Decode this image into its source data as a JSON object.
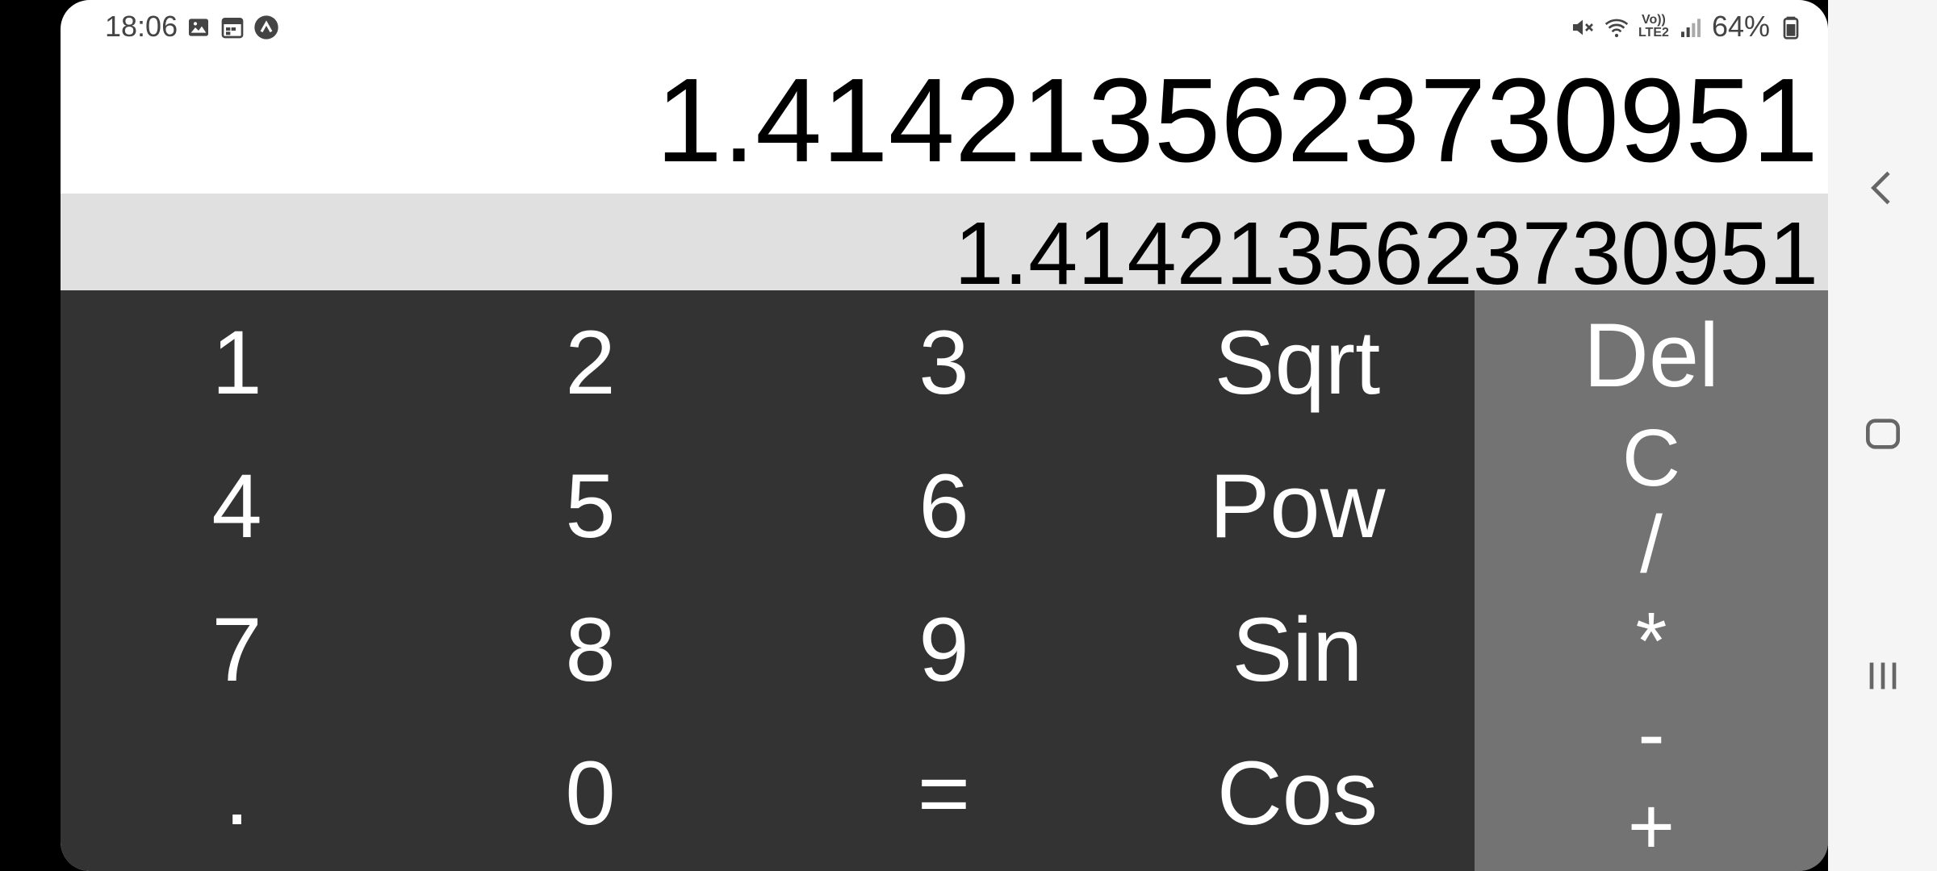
{
  "status_bar": {
    "time": "18:06",
    "left_icons": [
      "image-icon",
      "calendar-icon",
      "app-notification-icon"
    ],
    "right_icons": [
      "mute-icon",
      "wifi-icon",
      "volte-icon",
      "signal-icon"
    ],
    "volte_label": "Vo)) LTE2",
    "battery_percent": "64%"
  },
  "display": {
    "main_value": "1.4142135623730951",
    "secondary_value": "1.4142135623730951"
  },
  "keypad": {
    "rows": [
      [
        "1",
        "2",
        "3",
        "Sqrt"
      ],
      [
        "4",
        "5",
        "6",
        "Pow"
      ],
      [
        "7",
        "8",
        "9",
        "Sin"
      ],
      [
        ".",
        "0",
        "=",
        "Cos"
      ]
    ],
    "operators": [
      "Del",
      "C",
      "/",
      "*",
      "-",
      "+"
    ]
  },
  "nav_bar": {
    "buttons": [
      "back-icon",
      "home-icon",
      "recents-icon"
    ]
  },
  "colors": {
    "keypad_bg": "#333333",
    "operators_bg": "#737373",
    "secondary_display_bg": "#e0e0e0",
    "text_on_keys": "#ffffff"
  }
}
